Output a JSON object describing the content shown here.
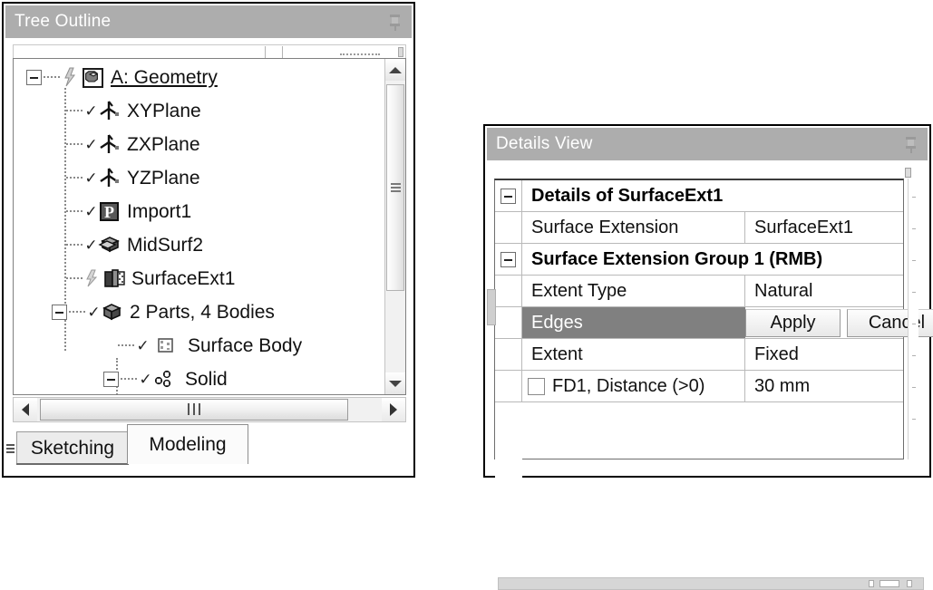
{
  "tree_panel": {
    "title": "Tree Outline",
    "pin_icon": "pushpin-icon",
    "items": [
      {
        "label": "A: Geometry",
        "icon": "geometry-cube-icon",
        "depth": 0,
        "expander": "minus",
        "check": "refresh-bolt",
        "underline": true
      },
      {
        "label": "XYPlane",
        "icon": "plane-axis-icon",
        "depth": 1,
        "expander": "none",
        "check": "check"
      },
      {
        "label": "ZXPlane",
        "icon": "plane-axis-icon",
        "depth": 1,
        "expander": "none",
        "check": "check"
      },
      {
        "label": "YZPlane",
        "icon": "plane-axis-icon",
        "depth": 1,
        "expander": "none",
        "check": "check"
      },
      {
        "label": "Import1",
        "icon": "import-p-icon",
        "depth": 1,
        "expander": "none",
        "check": "check"
      },
      {
        "label": "MidSurf2",
        "icon": "midsurface-icon",
        "depth": 1,
        "expander": "none",
        "check": "check"
      },
      {
        "label": "SurfaceExt1",
        "icon": "surface-extension-icon",
        "depth": 1,
        "expander": "none",
        "check": "refresh-bolt"
      },
      {
        "label": "2 Parts, 4 Bodies",
        "icon": "parts-bodies-icon",
        "depth": 1,
        "expander": "minus",
        "check": "check"
      },
      {
        "label": "Surface Body",
        "icon": "surface-body-icon",
        "depth": 2,
        "expander": "none",
        "check": "check"
      },
      {
        "label": "Solid",
        "icon": "solid-body-icon",
        "depth": 2,
        "expander": "minus",
        "check": "check"
      }
    ],
    "vscroll": {
      "up_icon": "scroll-up-arrow-icon",
      "down_icon": "scroll-down-arrow-icon",
      "thumb_grip": "grip-lines"
    },
    "hscroll": {
      "left_icon": "scroll-left-arrow-icon",
      "right_icon": "scroll-right-arrow-icon",
      "thumb_grip": "grip-lines"
    },
    "tabs": [
      {
        "label": "Sketching",
        "active": false
      },
      {
        "label": "Modeling",
        "active": true
      }
    ]
  },
  "details_panel": {
    "title": "Details View",
    "pin_icon": "pushpin-icon",
    "rows": [
      {
        "kind": "group",
        "expander": "minus",
        "text": "Details of SurfaceExt1"
      },
      {
        "kind": "prop",
        "key": "Surface Extension",
        "value": "SurfaceExt1"
      },
      {
        "kind": "group",
        "expander": "minus",
        "text": "Surface Extension Group 1  (RMB)"
      },
      {
        "kind": "prop",
        "key": "Extent Type",
        "value": "Natural"
      },
      {
        "kind": "action",
        "key": "Edges",
        "highlight": true,
        "buttons": [
          {
            "label": "Apply"
          },
          {
            "label": "Cancel"
          }
        ]
      },
      {
        "kind": "prop",
        "key": "Extent",
        "value": "Fixed"
      },
      {
        "kind": "checkprop",
        "checkbox": false,
        "key": "FD1,  Distance (>0)",
        "value": "30 mm"
      }
    ]
  },
  "colors": {
    "titlebar_bg": "#adadad",
    "titlebar_text": "#ffffff",
    "highlight_row_bg": "#808080",
    "highlight_row_text": "#ffffff",
    "panel_border": "#000000",
    "grid_line": "#b9b9b9",
    "page_bg": "#ffffff"
  }
}
